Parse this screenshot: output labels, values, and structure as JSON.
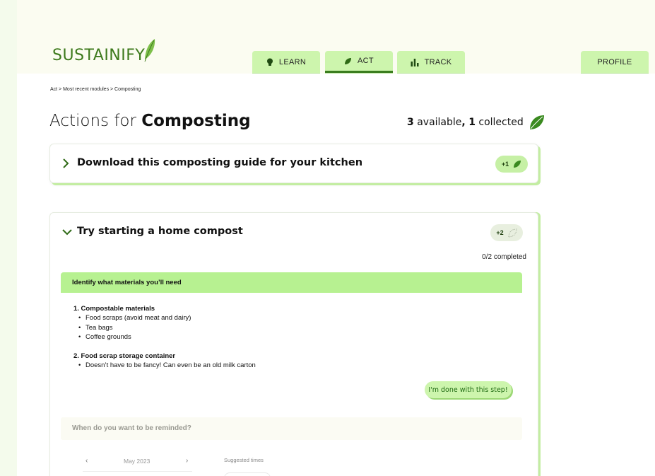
{
  "app": {
    "logo_text": "SUSTAINIFY"
  },
  "nav": {
    "learn_label": "LEARN",
    "act_label": "ACT",
    "track_label": "TRACK",
    "profile_label": "PROFILE",
    "active_tab": "ACT"
  },
  "breadcrumb": "Act > Most recent modules > Composting",
  "page": {
    "title_prefix": "Actions for ",
    "title_topic": "Composting",
    "available_count": "3",
    "available_label": " available",
    "comma": ",",
    "collected_count": "1",
    "collected_label": " collected"
  },
  "actions": [
    {
      "title": "Download this composting guide for your kitchen",
      "reward": "+1",
      "expanded": false
    },
    {
      "title": "Try starting a home compost",
      "reward": "+2",
      "expanded": true,
      "progress": "0/2 completed",
      "step": {
        "title": "Identify what materials you’ll need",
        "sections": [
          {
            "heading": "1. Compostable materials",
            "bullets": [
              "Food scraps (avoid meat and dairy)",
              "Tea bags",
              "Coffee grounds"
            ]
          },
          {
            "heading": "2. Food scrap storage container",
            "bullets": [
              "Doesn’t have to be fancy! Can even be an old milk carton"
            ]
          }
        ],
        "done_label": "I'm done with this step!"
      },
      "reminder": {
        "title": "When do you want to be reminded?",
        "prev": "‹",
        "month": "May 2023",
        "next": "›",
        "suggested_label": "Suggested times"
      }
    }
  ],
  "colors": {
    "brand_green": "#3d7a1c",
    "tab_green": "#cdf5ad",
    "step_header": "#b7f191",
    "leaf": "#3a8a1f"
  },
  "icons": [
    "leaf-icon",
    "lightbulb-icon",
    "bar-chart-icon",
    "chevron-right-icon",
    "chevron-down-icon"
  ]
}
